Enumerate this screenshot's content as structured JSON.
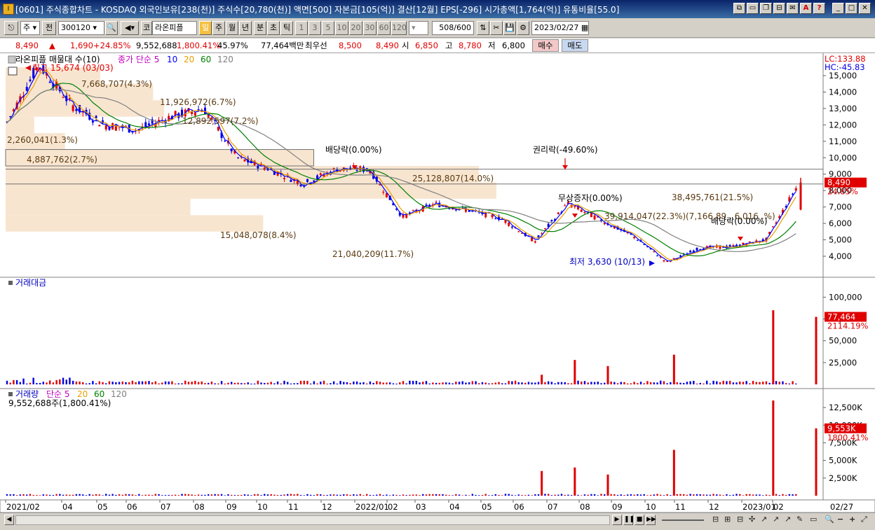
{
  "title": "[0601] 주식종합차트 - KOSDAQ 외국인보유[238(천)] 주식수[20,780(천)] 액면[500] 자본금[105(억)] 결산[12월] EPS[-296] 시가총액[1,764(억)] 유통비율[55.0]",
  "toolbar": {
    "period_select": "주",
    "prev_label": "전",
    "stock_code": "300120",
    "market_btn": "코",
    "stock_name": "라온피플",
    "periods": [
      "일",
      "주",
      "월",
      "년",
      "분",
      "초",
      "틱"
    ],
    "active_period": "일",
    "minute_steps": [
      "1",
      "3",
      "5",
      "10",
      "20",
      "30",
      "60",
      "120"
    ],
    "data_count": "508",
    "data_max": "/600",
    "date": "2023/02/27"
  },
  "quote": {
    "price": "8,490",
    "arrow": "▲",
    "change": "1,690",
    "change_pct": "+24.85%",
    "volume": "9,552,688",
    "volume_ratio": "1,800.41%",
    "turnover": "45.97%",
    "amount": "77,464백만",
    "best_label": "최우선",
    "best_ask": "8,500",
    "best_bid": "8,490",
    "open_label": "시",
    "open": "6,850",
    "high_label": "고",
    "high": "8,780",
    "low_label": "저",
    "low": "6,800",
    "buy_btn": "매수",
    "sell_btn": "매도"
  },
  "price_panel": {
    "legend_name": "라온피플 매물대 수(10)",
    "legend_ma": "종가 단순 5",
    "ma_periods": [
      "10",
      "20",
      "60",
      "120"
    ],
    "ma_colors": [
      "#c000c0",
      "#0000ff",
      "#e8a000",
      "#008000",
      "#808080"
    ],
    "lc": "LC:133.88",
    "hc": "HC:-45.83",
    "high_marker": "최고 15,674 (03/03)",
    "low_marker": "최저 3,630 (10/13)",
    "current_price": "8,490",
    "current_pct": "24.85%",
    "events": [
      "배당락(0.00%)",
      "권리락(-49.60%)",
      "무상증자(0.00%)",
      "배당락(0.00%)"
    ],
    "yticks": [
      "15,000",
      "14,000",
      "13,000",
      "12,000",
      "11,000",
      "10,000",
      "9,000",
      "8,000",
      "7,000",
      "6,000",
      "5,000",
      "4,000"
    ],
    "volume_profile": [
      {
        "label": "7,668,707(4.3%)",
        "price_low": 14500,
        "price_high": 15500,
        "pct": 4.3
      },
      {
        "label": "11,926,972(6.7%)",
        "price_low": 13500,
        "price_high": 14500,
        "pct": 6.7
      },
      {
        "label": "12,892,597(7.2%)",
        "price_low": 12500,
        "price_high": 13500,
        "pct": 7.2
      },
      {
        "label": "2,260,041(1.3%)",
        "price_low": 11500,
        "price_high": 12500,
        "pct": 1.3
      },
      {
        "label": "4,887,762(2.7%)",
        "price_low": 10500,
        "price_high": 11500,
        "pct": 2.7
      },
      {
        "label": "25,128,807(14.0%)",
        "price_low": 9500,
        "price_high": 10500,
        "pct": 14.0
      },
      {
        "label": "38,495,761(21.5%)",
        "price_low": 8500,
        "price_high": 9500,
        "pct": 21.5
      },
      {
        "label": "39,914,047(22.3%)",
        "price_low": 7500,
        "price_high": 8500,
        "pct": 22.3
      },
      {
        "label": "15,048,078(8.4%)",
        "price_low": 6500,
        "price_high": 7500,
        "pct": 8.4
      },
      {
        "label": "21,040,209(11.7%)",
        "price_low": 5500,
        "price_high": 6500,
        "pct": 11.7
      }
    ],
    "extra_label": "(7,166,89 , 6,016 ,%)"
  },
  "amount_panel": {
    "legend": "거래대금",
    "value": "77,464",
    "pct": "2114.19%",
    "yticks": [
      "100,000",
      "75,000",
      "50,000",
      "25,000"
    ]
  },
  "volume_panel": {
    "legend_name": "거래량",
    "legend_ma": "단순 5",
    "ma_periods": [
      "20",
      "60",
      "120"
    ],
    "sub": "9,552,688주(1,800.41%)",
    "value": "9,553K",
    "pct": "1800.41%",
    "yticks": [
      "12,500K",
      "10,000K",
      "7,500K",
      "5,000K",
      "2,500K"
    ]
  },
  "xaxis": {
    "labels": [
      "2021/02",
      "04",
      "05",
      "06",
      "07",
      "08",
      "09",
      "10",
      "11",
      "12",
      "2022/01",
      "02",
      "03",
      "04",
      "05",
      "06",
      "07",
      "08",
      "09",
      "10",
      "11",
      "12",
      "2023/01",
      "02"
    ],
    "right_label": "02/27"
  },
  "chart_data": {
    "type": "candlestick",
    "title": "라온피플",
    "ylim": [
      3630,
      15674
    ],
    "price_path": [
      [
        "2021/02",
        12000
      ],
      [
        "2021/03",
        15674
      ],
      [
        "2021/04",
        13200
      ],
      [
        "2021/05",
        12000
      ],
      [
        "2021/06",
        11700
      ],
      [
        "2021/07",
        12500
      ],
      [
        "2021/08",
        13000
      ],
      [
        "2021/08",
        10000
      ],
      [
        "2021/10",
        9300
      ],
      [
        "2021/11",
        8400
      ],
      [
        "2021/12",
        9300
      ],
      [
        "2022/01",
        9300
      ],
      [
        "2022/02",
        6400
      ],
      [
        "2022/03",
        7200
      ],
      [
        "2022/04",
        6800
      ],
      [
        "2022/05",
        6300
      ],
      [
        "2022/06",
        4900
      ],
      [
        "2022/07",
        7200
      ],
      [
        "2022/08",
        6200
      ],
      [
        "2022/09",
        5200
      ],
      [
        "2022/10",
        3630
      ],
      [
        "2022/11",
        4500
      ],
      [
        "2022/12",
        4600
      ],
      [
        "2023/01",
        5000
      ],
      [
        "2023/02",
        8490
      ]
    ],
    "amount_spikes_millions": [
      [
        "2022/06",
        11000
      ],
      [
        "2022/07",
        28000
      ],
      [
        "2022/08",
        21000
      ],
      [
        "2022/10",
        34000
      ],
      [
        "2023/01",
        85000
      ],
      [
        "2023/02",
        77464
      ]
    ],
    "volume_spikes_thousands": [
      [
        "2022/06",
        3500
      ],
      [
        "2022/07",
        4000
      ],
      [
        "2022/08",
        3000
      ],
      [
        "2022/10",
        6500
      ],
      [
        "2023/01",
        13500
      ],
      [
        "2023/02",
        9553
      ]
    ]
  }
}
